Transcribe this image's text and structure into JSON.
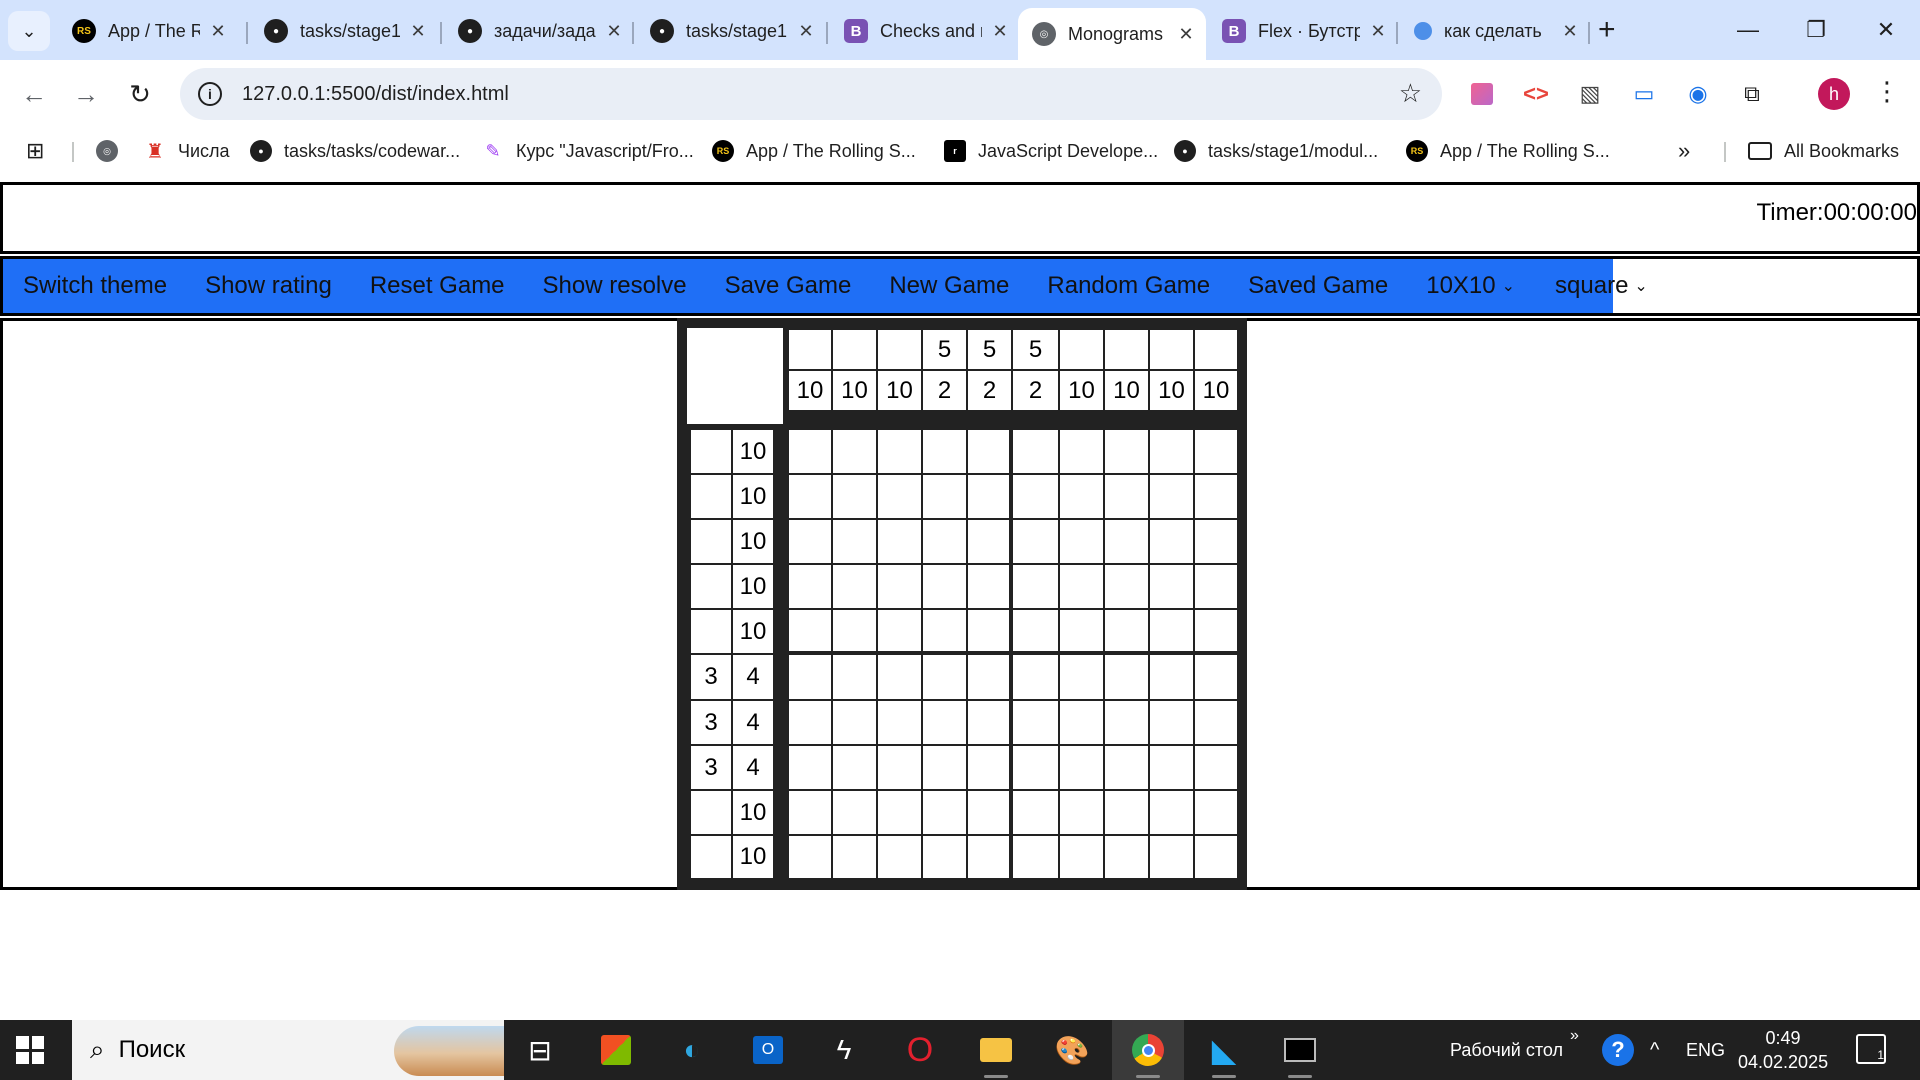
{
  "browser": {
    "tabs": [
      {
        "title": "App / The Rolling Scopes",
        "favicon": "rs-logo-icon",
        "active": false
      },
      {
        "title": "tasks/stage1",
        "favicon": "github-icon",
        "active": false
      },
      {
        "title": "задачи/задачи",
        "favicon": "github-icon",
        "active": false
      },
      {
        "title": "tasks/stage1",
        "favicon": "github-icon",
        "active": false
      },
      {
        "title": "Checks and radios",
        "favicon": "bootstrap-icon",
        "active": false
      },
      {
        "title": "Monograms",
        "favicon": "globe-icon",
        "active": true
      },
      {
        "title": "Flex · Бутстрап",
        "favicon": "bootstrap-icon",
        "active": false
      },
      {
        "title": "как сделать",
        "favicon": "google-lens-icon",
        "active": false
      }
    ],
    "url": "127.0.0.1:5500/dist/index.html",
    "profile_initial": "h",
    "bookmarks": [
      {
        "label": "",
        "icon": "globe-icon"
      },
      {
        "label": "Числа",
        "icon": "tower-icon"
      },
      {
        "label": "tasks/tasks/codewar...",
        "icon": "github-icon"
      },
      {
        "label": "Курс \"Javascript/Fro...",
        "icon": "pen-icon"
      },
      {
        "label": "App / The Rolling S...",
        "icon": "rs-logo-icon"
      },
      {
        "label": "JavaScript Develope...",
        "icon": "js-icon"
      },
      {
        "label": "tasks/stage1/modul...",
        "icon": "github-icon"
      },
      {
        "label": "App / The Rolling S...",
        "icon": "rs-logo-icon"
      }
    ],
    "all_bookmarks": "All Bookmarks"
  },
  "app": {
    "timer": "Timer:00:00:00",
    "menu": {
      "switch_theme": "Switch theme",
      "show_rating": "Show rating",
      "reset_game": "Reset Game",
      "show_resolve": "Show resolve",
      "save_game": "Save Game",
      "new_game": "New Game",
      "random_game": "Random Game",
      "saved_game": "Saved Game",
      "size_select": "10X10",
      "shape_select": "square"
    },
    "menu_color": "#1f6ff6",
    "puzzle": {
      "column_clues": [
        [
          "",
          "10"
        ],
        [
          "",
          "10"
        ],
        [
          "",
          "10"
        ],
        [
          "5",
          "2"
        ],
        [
          "5",
          "2"
        ],
        [
          "5",
          "2"
        ],
        [
          "",
          "10"
        ],
        [
          "",
          "10"
        ],
        [
          "",
          "10"
        ],
        [
          "",
          "10"
        ]
      ],
      "row_clues": [
        [
          "",
          "10"
        ],
        [
          "",
          "10"
        ],
        [
          "",
          "10"
        ],
        [
          "",
          "10"
        ],
        [
          "",
          "10"
        ],
        [
          "3",
          "4"
        ],
        [
          "3",
          "4"
        ],
        [
          "3",
          "4"
        ],
        [
          "",
          "10"
        ],
        [
          "",
          "10"
        ]
      ],
      "grid_size": 10
    }
  },
  "taskbar": {
    "search_placeholder": "Поиск",
    "desktop_label": "Рабочий стол",
    "language": "ENG",
    "time": "0:49",
    "date": "04.02.2025",
    "notifications": "1",
    "apps": [
      "task-view-icon",
      "microsoft-store-icon",
      "edge-icon",
      "outlook-icon",
      "winamp-icon",
      "opera-icon",
      "file-explorer-icon",
      "paint-icon",
      "chrome-icon",
      "vscode-icon",
      "terminal-icon"
    ]
  }
}
